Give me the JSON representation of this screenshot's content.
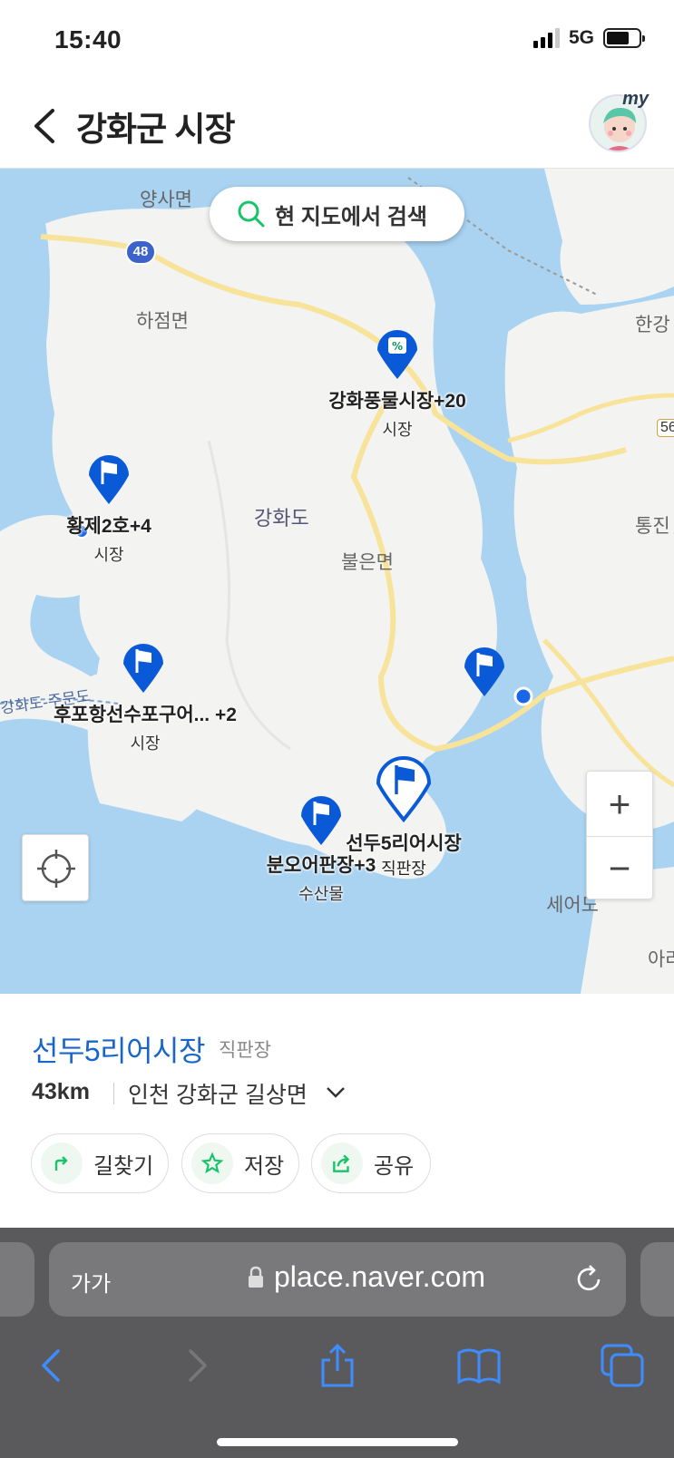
{
  "status": {
    "time": "15:40",
    "network": "5G"
  },
  "header": {
    "title": "강화군 시장",
    "avatar_badge": "my"
  },
  "map": {
    "search_button": "현 지도에서 검색",
    "route_number": "48",
    "labels": {
      "yangsa": "양사면",
      "hajeom": "하점면",
      "ganghwado": "강화도",
      "bureun": "불은면",
      "hangang": "한강",
      "tongjin": "통진",
      "seeodo": "세어도",
      "ara": "아라",
      "jumun": "강화도-주문도",
      "road_56": "56"
    },
    "pins": [
      {
        "name": "강화풍물시장+20",
        "category": "시장"
      },
      {
        "name": "황제2호+4",
        "category": "시장"
      },
      {
        "name": "후포항선수포구어... +2",
        "category": "시장"
      },
      {
        "name": "분오어판장+3",
        "category": "수산물"
      },
      {
        "name": "선두5리어시장",
        "category": "직판장"
      }
    ],
    "zoom_in": "+",
    "zoom_out": "−"
  },
  "place": {
    "name": "선두5리어시장",
    "category": "직판장",
    "distance": "43km",
    "address": "인천 강화군 길상면",
    "actions": {
      "directions": "길찾기",
      "save": "저장",
      "share": "공유"
    }
  },
  "browser": {
    "text_size": "가가",
    "url": "place.naver.com"
  },
  "colors": {
    "accent": "#1a66c8",
    "pin": "#0a5ad7",
    "water": "#a9d3f1",
    "land": "#f4f4f2"
  }
}
